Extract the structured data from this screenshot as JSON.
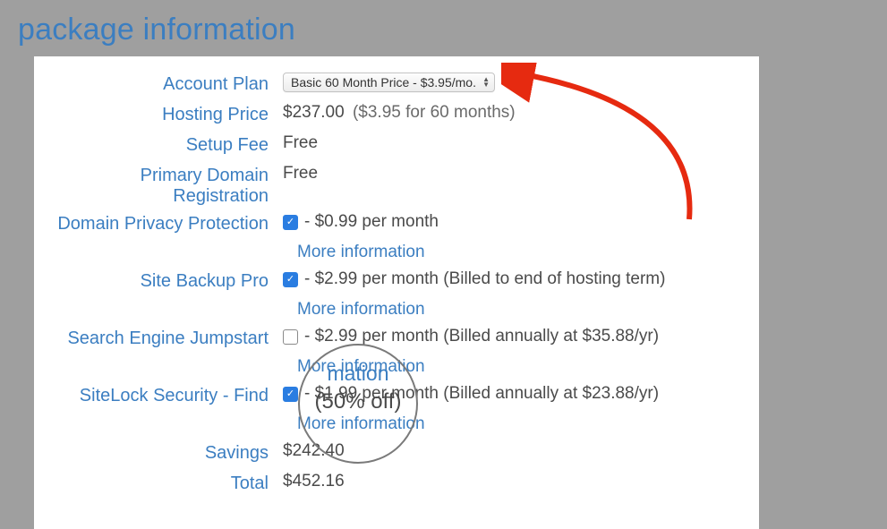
{
  "page_title": "package information",
  "labels": {
    "account_plan": "Account Plan",
    "hosting_price": "Hosting Price",
    "setup_fee": "Setup Fee",
    "domain_registration": "Primary Domain Registration",
    "domain_privacy": "Domain Privacy Protection",
    "site_backup": "Site Backup Pro",
    "search_engine": "Search Engine Jumpstart",
    "sitelock": "SiteLock Security - Find",
    "savings": "Savings",
    "total": "Total"
  },
  "values": {
    "account_plan_selected": "Basic 60 Month Price - $3.95/mo.",
    "hosting_price": "$237.00",
    "hosting_price_extra": "($3.95 for 60 months)",
    "setup_fee": "Free",
    "domain_registration": "Free",
    "domain_privacy_price": "- $0.99 per month",
    "site_backup_price": "- $2.99 per month (Billed to end of hosting term)",
    "search_engine_price": "- $2.99 per month (Billed annually at $35.88/yr)",
    "sitelock_price": "- $1.99 per month (Billed annually at $23.88/yr)",
    "savings": "$242.40",
    "total": "$452.16"
  },
  "more_info": "More information",
  "magnifier": {
    "line1": "mation",
    "line2": "(50% off)"
  },
  "checkboxes": {
    "domain_privacy": true,
    "site_backup": true,
    "search_engine": false,
    "sitelock": true
  }
}
